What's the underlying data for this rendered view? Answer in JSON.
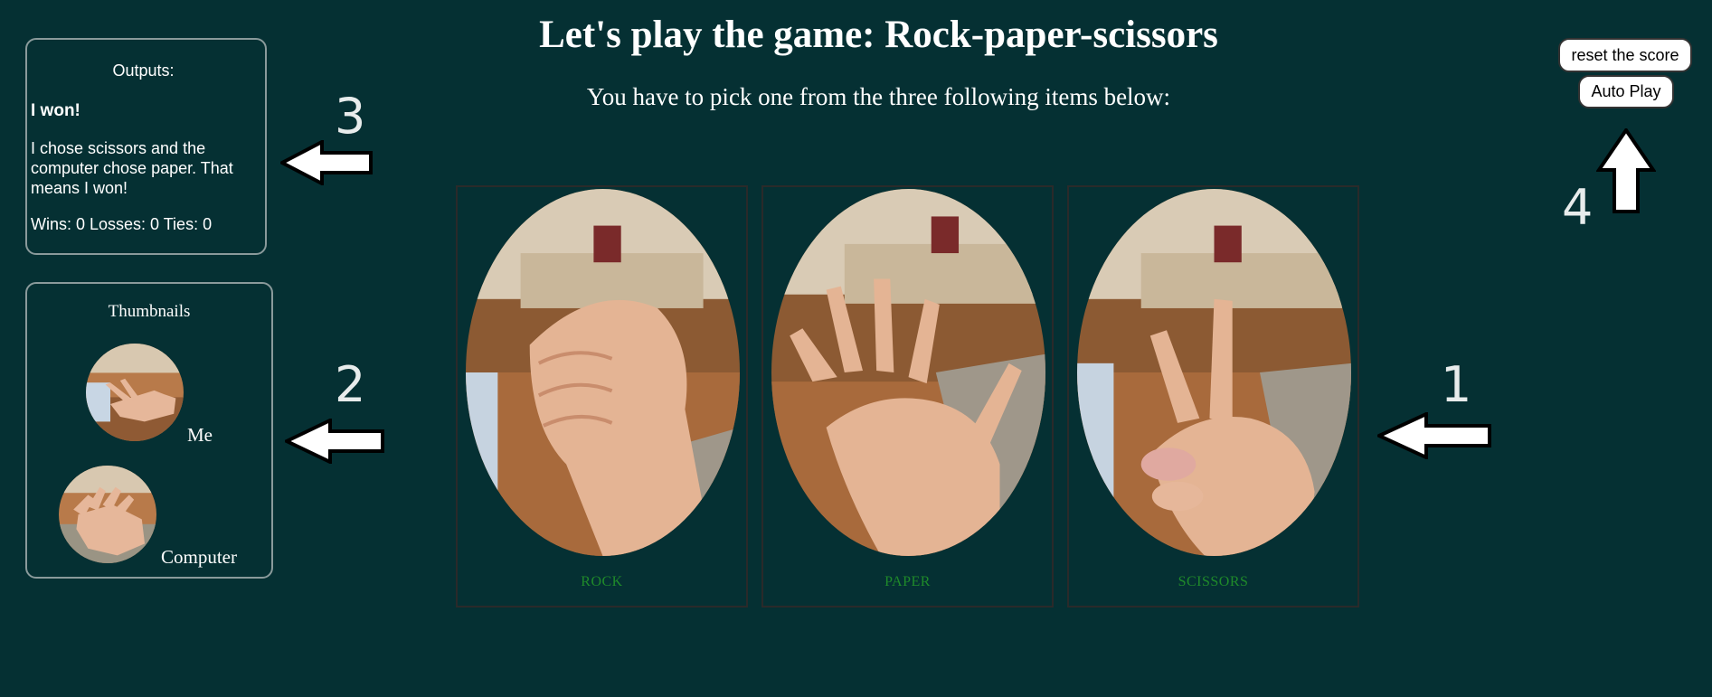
{
  "header": {
    "title": "Let's play the game: Rock-paper-scissors",
    "subtitle": "You have to pick one from the three following items below:"
  },
  "outputs": {
    "heading": "Outputs:",
    "result": "I won!",
    "explanation": "I chose scissors and the computer chose paper. That means I won!",
    "score": "Wins: 0 Losses: 0 Ties: 0"
  },
  "thumbnails": {
    "heading": "Thumbnails",
    "me_label": "Me",
    "computer_label": "Computer",
    "me_choice_icon": "scissors-hand",
    "computer_choice_icon": "paper-hand"
  },
  "choices": [
    {
      "label": "ROCK",
      "icon": "rock-fist"
    },
    {
      "label": "PAPER",
      "icon": "paper-hand"
    },
    {
      "label": "SCISSORS",
      "icon": "scissors-hand"
    }
  ],
  "controls": {
    "reset_label": "reset the score",
    "autoplay_label": "Auto Play"
  },
  "annotations": {
    "n1": "1",
    "n2": "2",
    "n3": "3",
    "n4": "4"
  },
  "colors": {
    "background": "#053033",
    "choice_label": "#1f8a2a",
    "panel_border": "#8a9a9b"
  }
}
